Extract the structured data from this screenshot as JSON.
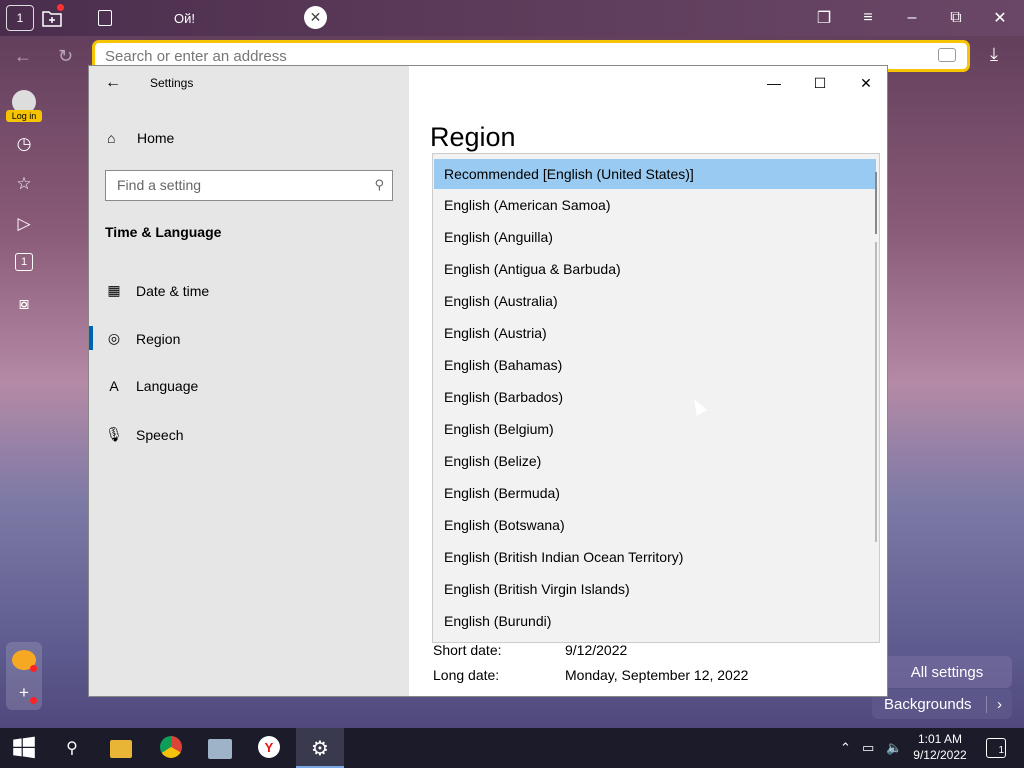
{
  "browser": {
    "home_tab_number": "1",
    "tab_title": "Ой!",
    "address_placeholder": "Search or enter an address",
    "login_label": "Log in",
    "sidebar_counter": "1",
    "accent_color": "#f6c400"
  },
  "settings": {
    "window_title": "Settings",
    "home_label": "Home",
    "search_placeholder": "Find a setting",
    "section_title": "Time & Language",
    "nav_items": [
      {
        "label": "Date & time",
        "icon": "calendar-clock-icon"
      },
      {
        "label": "Region",
        "icon": "globe-icon"
      },
      {
        "label": "Language",
        "icon": "language-icon"
      },
      {
        "label": "Speech",
        "icon": "microphone-icon"
      }
    ],
    "selected_nav": "Region",
    "page_title": "Region",
    "region_options": [
      "Recommended [English (United States)]",
      "English (American Samoa)",
      "English (Anguilla)",
      "English (Antigua & Barbuda)",
      "English (Australia)",
      "English (Austria)",
      "English (Bahamas)",
      "English (Barbados)",
      "English (Belgium)",
      "English (Belize)",
      "English (Bermuda)",
      "English (Botswana)",
      "English (British Indian Ocean Territory)",
      "English (British Virgin Islands)",
      "English (Burundi)"
    ],
    "info": [
      {
        "label": "Short date:",
        "value": "9/12/2022"
      },
      {
        "label": "Long date:",
        "value": "Monday, September 12, 2022"
      }
    ]
  },
  "newtab": {
    "all_settings": "All settings",
    "backgrounds": "Backgrounds"
  },
  "taskbar": {
    "time": "1:01 AM",
    "date": "9/12/2022",
    "notification_count": "1"
  }
}
